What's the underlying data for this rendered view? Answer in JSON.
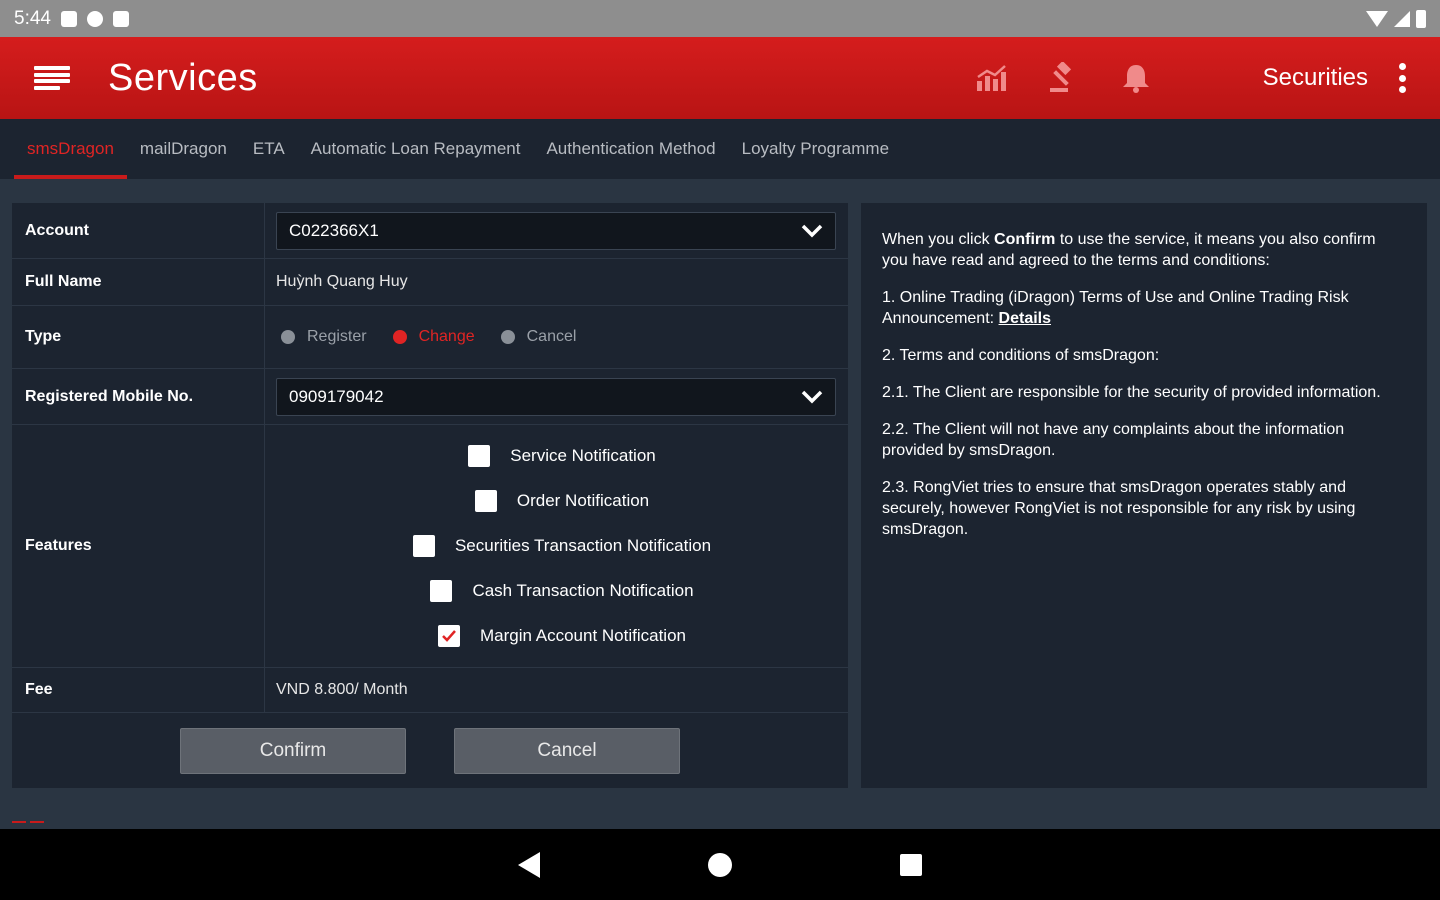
{
  "status_bar": {
    "time": "5:44"
  },
  "app_bar": {
    "title": "Services",
    "securities_label": "Securities"
  },
  "tabs": [
    {
      "label": "smsDragon",
      "active": true
    },
    {
      "label": "mailDragon",
      "active": false
    },
    {
      "label": "ETA",
      "active": false
    },
    {
      "label": "Automatic Loan Repayment",
      "active": false
    },
    {
      "label": "Authentication Method",
      "active": false
    },
    {
      "label": "Loyalty Programme",
      "active": false
    }
  ],
  "form": {
    "account": {
      "label": "Account",
      "value": "C022366X1"
    },
    "full_name": {
      "label": "Full Name",
      "value": "Huỳnh Quang Huy"
    },
    "type": {
      "label": "Type",
      "options": [
        {
          "label": "Register",
          "selected": false
        },
        {
          "label": "Change",
          "selected": true
        },
        {
          "label": "Cancel",
          "selected": false
        }
      ]
    },
    "mobile": {
      "label": "Registered Mobile No.",
      "value": "0909179042"
    },
    "features": {
      "label": "Features",
      "items": [
        {
          "label": "Service Notification",
          "checked": false
        },
        {
          "label": "Order Notification",
          "checked": false
        },
        {
          "label": "Securities Transaction Notification",
          "checked": false
        },
        {
          "label": "Cash Transaction Notification",
          "checked": false
        },
        {
          "label": "Margin Account Notification",
          "checked": true
        }
      ]
    },
    "fee": {
      "label": "Fee",
      "value": "VND 8.800/ Month"
    },
    "confirm_label": "Confirm",
    "cancel_label": "Cancel"
  },
  "terms": {
    "intro_before": "When you click",
    "intro_bold": "Confirm",
    "intro_after": "to use the service, it means you also confirm you have read and agreed to the terms and conditions:",
    "item1": "1. Online Trading (iDragon) Terms of Use and Online Trading Risk Announcement:",
    "item1_link": "Details",
    "item2": "2. Terms and conditions of smsDragon:",
    "item2_1": "2.1. The Client are responsible for the security of provided information.",
    "item2_2": "2.2. The Client will not have any complaints about the information provided by smsDragon.",
    "item2_3": "2.3. RongViet tries to ensure that smsDragon operates stably and securely, however RongViet is not responsible for any risk by using smsDragon."
  },
  "colors": {
    "accent": "#c81b1b",
    "panel": "#1c2430",
    "background": "#2a3542"
  }
}
